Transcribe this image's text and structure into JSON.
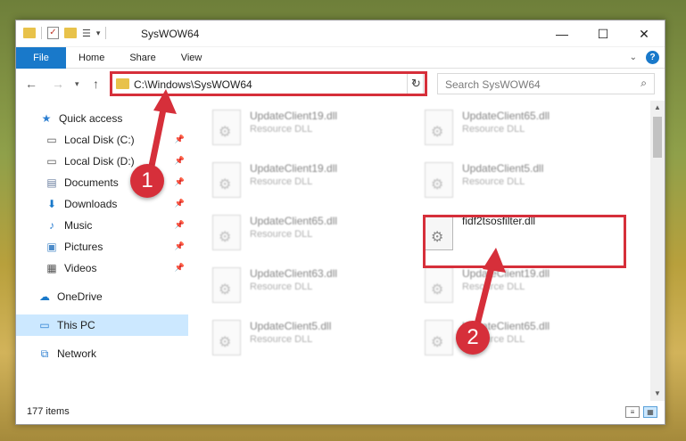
{
  "window": {
    "title": "SysWOW64"
  },
  "caption_buttons": {
    "minimize": "—",
    "maximize": "☐",
    "close": "✕"
  },
  "ribbon": {
    "tabs": [
      "File",
      "Home",
      "Share",
      "View"
    ],
    "help_label": "?"
  },
  "address": {
    "path": "C:\\Windows\\SysWOW64",
    "refresh_icon": "↻",
    "dropdown_icon": "⌄"
  },
  "search": {
    "placeholder": "Search SysWOW64",
    "icon": "⌕"
  },
  "sidebar": {
    "items": [
      {
        "label": "Quick access",
        "icon": "star-icon"
      },
      {
        "label": "Local Disk (C:)",
        "icon": "drive-icon"
      },
      {
        "label": "Local Disk (D:)",
        "icon": "drive-icon"
      },
      {
        "label": "Documents",
        "icon": "documents-icon"
      },
      {
        "label": "Downloads",
        "icon": "downloads-icon"
      },
      {
        "label": "Music",
        "icon": "music-icon"
      },
      {
        "label": "Pictures",
        "icon": "pictures-icon"
      },
      {
        "label": "Videos",
        "icon": "videos-icon"
      },
      {
        "label": "OneDrive",
        "icon": "cloud-icon"
      },
      {
        "label": "This PC",
        "icon": "computer-icon"
      },
      {
        "label": "Network",
        "icon": "network-icon"
      }
    ]
  },
  "files": {
    "items": [
      {
        "name": "UpdateClient19.dll",
        "type": "Resource DLL"
      },
      {
        "name": "UpdateClient65.dll",
        "type": "Resource DLL"
      },
      {
        "name": "UpdateClient19.dll",
        "type": "Resource DLL"
      },
      {
        "name": "UpdateClient5.dll",
        "type": "Resource DLL"
      },
      {
        "name": "UpdateClient65.dll",
        "type": "Resource DLL"
      },
      {
        "name": "fidf2tsosfilter.dll",
        "type": ""
      },
      {
        "name": "UpdateClient63.dll",
        "type": "Resource DLL"
      },
      {
        "name": "UpdateClient19.dll",
        "type": "Resource DLL"
      },
      {
        "name": "UpdateClient5.dll",
        "type": "Resource DLL"
      },
      {
        "name": "UpdateClient65.dll",
        "type": "Resource DLL"
      }
    ]
  },
  "status": {
    "item_count": "177 items"
  },
  "annotations": {
    "step1": "1",
    "step2": "2",
    "color": "#d62f3a"
  }
}
